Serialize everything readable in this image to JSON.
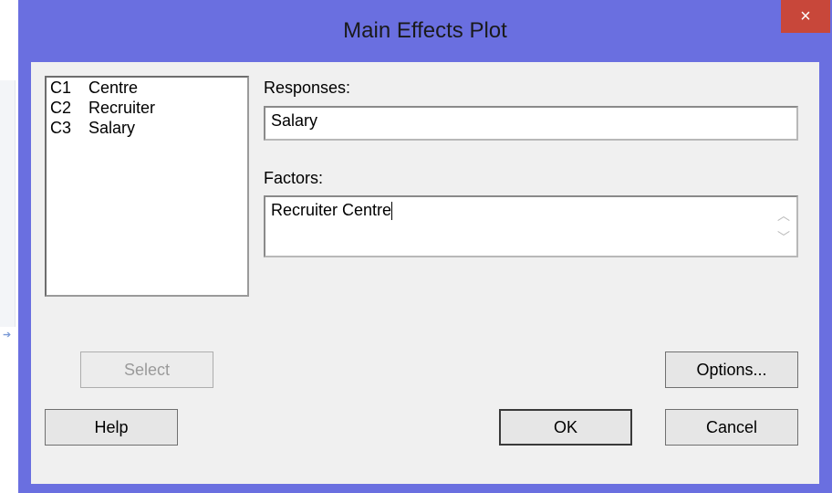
{
  "window": {
    "title": "Main Effects Plot",
    "close_glyph": "×"
  },
  "columns_list": [
    {
      "id": "C1",
      "name": "Centre"
    },
    {
      "id": "C2",
      "name": "Recruiter"
    },
    {
      "id": "C3",
      "name": "Salary"
    }
  ],
  "responses": {
    "label": "Responses:",
    "value": "Salary"
  },
  "factors": {
    "label": "Factors:",
    "value": "Recruiter Centre"
  },
  "buttons": {
    "select": "Select",
    "options": "Options...",
    "help": "Help",
    "ok": "OK",
    "cancel": "Cancel"
  },
  "colors": {
    "titlebar": "#6a6fe0",
    "close": "#c8473a",
    "client": "#f0f0f0"
  }
}
